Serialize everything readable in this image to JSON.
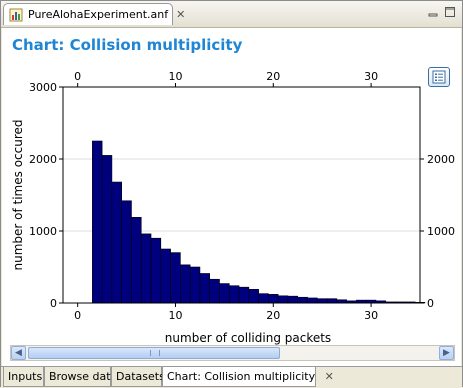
{
  "editor_tab": {
    "label": "PureAlohaExperiment.anf",
    "close_glyph": "✕"
  },
  "chart_title": "Chart: Collision multiplicity",
  "bottom_tabs": [
    {
      "label": "Inputs"
    },
    {
      "label": "Browse data"
    },
    {
      "label": "Datasets"
    },
    {
      "label": "Chart: Collision multiplicity",
      "close_glyph": "✕"
    }
  ],
  "colors": {
    "bar_fill": "#00007f",
    "title": "#1f86d6"
  },
  "chart_data": {
    "type": "bar",
    "xlabel": "number of colliding packets",
    "ylabel": "number of times occured",
    "xlim": [
      -1.5,
      35
    ],
    "ylim": [
      0,
      3000
    ],
    "x_ticks": [
      0,
      10,
      20,
      30
    ],
    "y_ticks_left": [
      0,
      1000,
      2000,
      3000
    ],
    "y_ticks_right": [
      0,
      1000,
      2000
    ],
    "grid": true,
    "categories": [
      2,
      3,
      4,
      5,
      6,
      7,
      8,
      9,
      10,
      11,
      12,
      13,
      14,
      15,
      16,
      17,
      18,
      19,
      20,
      21,
      22,
      23,
      24,
      25,
      26,
      27,
      28,
      29,
      30,
      31,
      32,
      33,
      34,
      35
    ],
    "values": [
      2250,
      2050,
      1680,
      1420,
      1190,
      960,
      900,
      750,
      700,
      530,
      500,
      410,
      330,
      270,
      240,
      220,
      190,
      130,
      120,
      100,
      95,
      80,
      70,
      60,
      60,
      45,
      30,
      40,
      40,
      30,
      15,
      15,
      15,
      10
    ]
  }
}
